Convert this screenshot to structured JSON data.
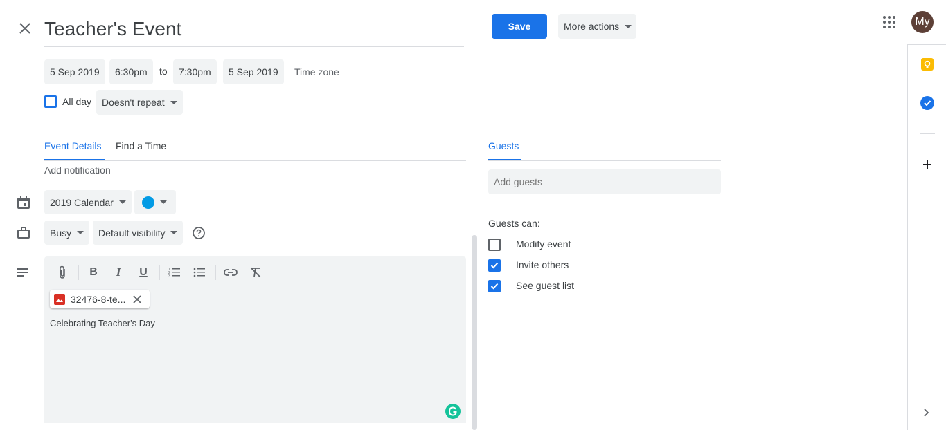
{
  "header": {
    "title": "Teacher's Event",
    "save_label": "Save",
    "more_actions_label": "More actions",
    "avatar_text": "My"
  },
  "datetime": {
    "start_date": "5 Sep 2019",
    "start_time": "6:30pm",
    "to_label": "to",
    "end_time": "7:30pm",
    "end_date": "5 Sep 2019",
    "time_zone_label": "Time zone",
    "all_day_label": "All day",
    "repeat_value": "Doesn't repeat"
  },
  "tabs": {
    "event_details": "Event Details",
    "find_a_time": "Find a Time",
    "guests": "Guests"
  },
  "details": {
    "add_notification": "Add notification",
    "calendar_value": "2019 Calendar",
    "calendar_color": "#039be5",
    "busy_value": "Busy",
    "visibility_value": "Default visibility",
    "attachment_name": "32476-8-te...",
    "description": "Celebrating Teacher's Day"
  },
  "guests": {
    "add_guests_placeholder": "Add guests",
    "guests_can_label": "Guests can:",
    "permissions": [
      {
        "label": "Modify event",
        "checked": false
      },
      {
        "label": "Invite others",
        "checked": true
      },
      {
        "label": "See guest list",
        "checked": true
      }
    ]
  },
  "colors": {
    "accent": "#1a73e8",
    "chip_bg": "#f1f3f4",
    "keep_yellow": "#fbbc04",
    "grammarly_green": "#15c39a"
  }
}
